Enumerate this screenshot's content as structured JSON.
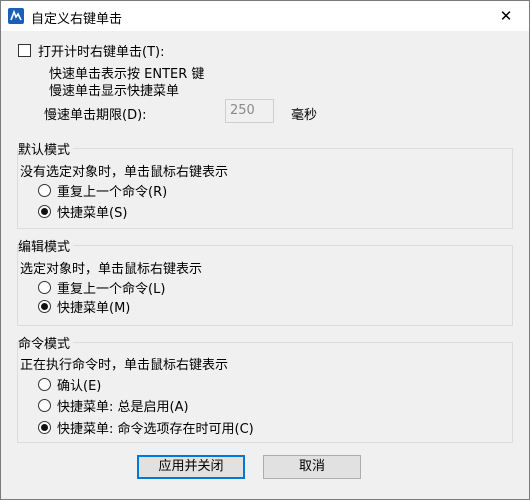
{
  "window": {
    "title": "自定义右键单击",
    "close_glyph": "✕"
  },
  "timer": {
    "checkbox_label": "打开计时右键单击(T):",
    "checked": false,
    "line_fast": "快速单击表示按 ENTER 键",
    "line_slow": "慢速单击显示快捷菜单",
    "limit_label": "慢速单击期限(D):",
    "limit_value": "250",
    "limit_unit": "毫秒"
  },
  "default_mode": {
    "title": "默认模式",
    "description": "没有选定对象时，单击鼠标右键表示",
    "options": [
      {
        "label": "重复上一个命令(R)",
        "selected": false
      },
      {
        "label": "快捷菜单(S)",
        "selected": true
      }
    ]
  },
  "edit_mode": {
    "title": "编辑模式",
    "description": "选定对象时，单击鼠标右键表示",
    "options": [
      {
        "label": "重复上一个命令(L)",
        "selected": false
      },
      {
        "label": "快捷菜单(M)",
        "selected": true
      }
    ]
  },
  "command_mode": {
    "title": "命令模式",
    "description": "正在执行命令时，单击鼠标右键表示",
    "options": [
      {
        "label": "确认(E)",
        "selected": false
      },
      {
        "label": "快捷菜单: 总是启用(A)",
        "selected": false
      },
      {
        "label": "快捷菜单: 命令选项存在时可用(C)",
        "selected": true
      }
    ]
  },
  "buttons": {
    "apply_close": "应用并关闭",
    "cancel": "取消"
  }
}
